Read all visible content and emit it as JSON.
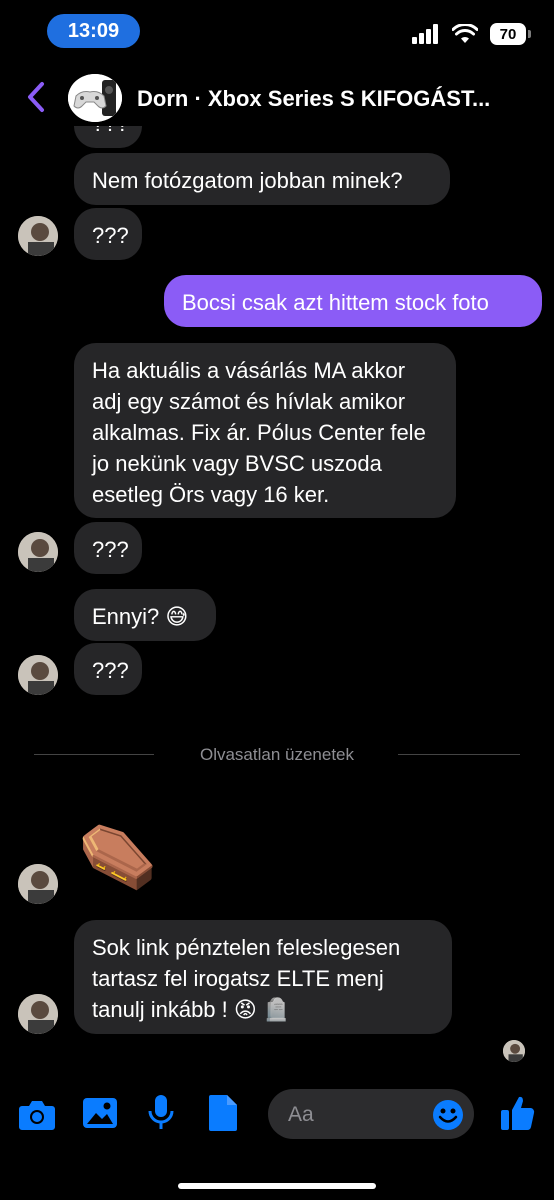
{
  "status": {
    "time": "13:09",
    "battery": "70"
  },
  "header": {
    "title": "Dorn · Xbox Series S KIFOGÁST..."
  },
  "messages": [
    {
      "text": "???"
    },
    {
      "text": "Nem fotózgatom jobban minek?"
    },
    {
      "text": "???"
    },
    {
      "text": "Bocsi csak azt hittem stock foto"
    },
    {
      "text": "Ha aktuális a vásárlás MA akkor adj egy számot és hívlak amikor alkalmas. Fix ár. Pólus Center fele jo nekünk vagy BVSC uszoda esetleg Örs vagy 16 ker."
    },
    {
      "text": "???"
    },
    {
      "text": "Ennyi? 😅"
    },
    {
      "text": "???"
    },
    {
      "text": "⚰️"
    },
    {
      "text": "Sok link pénztelen feleslegesen tartasz fel irogatsz ELTE menj tanulj inkább ! 😡 🪦"
    }
  ],
  "divider": {
    "label": "Olvasatlan üzenetek"
  },
  "composer": {
    "placeholder": "Aa"
  },
  "colors": {
    "accent": "#0a7cff",
    "outgoing": "#8b5cf6",
    "incoming": "#262628",
    "back": "#8b5cf6"
  },
  "icons": [
    "back-chevron-icon",
    "camera-icon",
    "image-icon",
    "microphone-icon",
    "document-icon",
    "emoji-icon",
    "thumbs-up-icon"
  ]
}
